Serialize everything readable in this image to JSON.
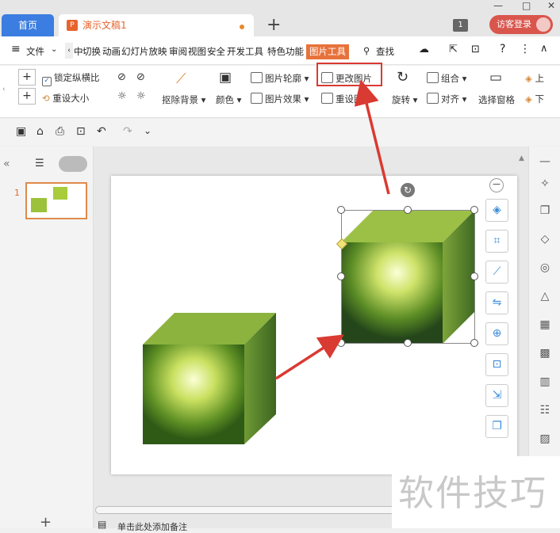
{
  "tabs": {
    "home": "首页",
    "doc": "演示文稿1",
    "new": "+"
  },
  "title_right": {
    "badge": "1",
    "login": "访客登录"
  },
  "window": {
    "minimize": "—",
    "maximize": "□",
    "close": "✕"
  },
  "menu": {
    "file": "文件",
    "items": [
      "中",
      "切换",
      "动画",
      "幻灯片放映",
      "审阅",
      "视图",
      "安全",
      "开发工具",
      "特色功能"
    ],
    "active": "图片工具",
    "search": "查找"
  },
  "ribbon": {
    "lock_ratio": "锁定纵横比",
    "reset_size": "重设大小",
    "remove_bg": "抠除背景",
    "color": "颜色",
    "pic_outline": "图片轮廓",
    "pic_effect": "图片效果",
    "change_pic": "更改图片",
    "reset_pic": "重设图片",
    "rotate": "旋转",
    "group": "组合",
    "align": "对齐",
    "selection_pane": "选择窗格",
    "up": "上",
    "down": "下"
  },
  "slide_panel": {
    "number": "1"
  },
  "notes": "单击此处添加备注",
  "watermark": "软件技巧",
  "colors": {
    "accent": "#e7723b",
    "highlight": "#d93a32",
    "tab_blue": "#3b7de0"
  }
}
